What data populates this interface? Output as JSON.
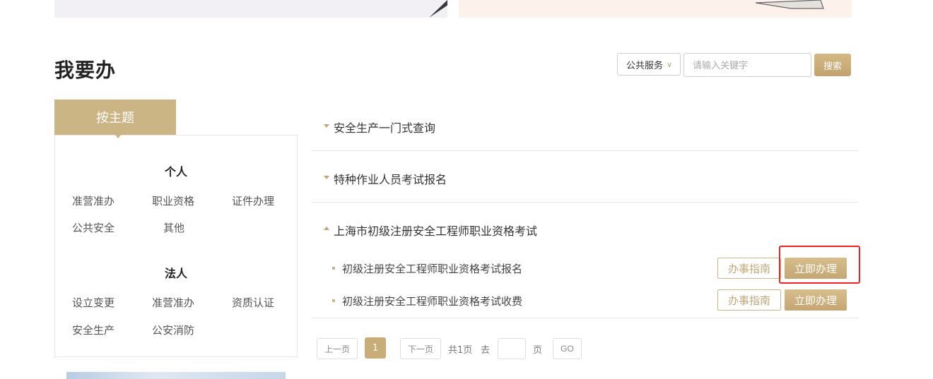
{
  "page": {
    "title": "我要办"
  },
  "search": {
    "scope_value": "公共服务",
    "placeholder": "请输入关键字",
    "button_label": "搜索"
  },
  "sidebar": {
    "tab_label": "按主题",
    "groups": [
      {
        "title": "个人",
        "items": [
          "准营准办",
          "职业资格",
          "证件办理",
          "公共安全",
          "其他"
        ]
      },
      {
        "title": "法人",
        "items": [
          "设立变更",
          "准营准办",
          "资质认证",
          "安全生产",
          "公安消防"
        ]
      }
    ]
  },
  "categories": [
    {
      "title": "安全生产一门式查询",
      "expanded": false
    },
    {
      "title": "特种作业人员考试报名",
      "expanded": false
    },
    {
      "title": "上海市初级注册安全工程师职业资格考试",
      "expanded": true,
      "items": [
        {
          "name": "初级注册安全工程师职业资格考试报名",
          "guide_label": "办事指南",
          "handle_label": "立即办理"
        },
        {
          "name": "初级注册安全工程师职业资格考试收费",
          "guide_label": "办事指南",
          "handle_label": "立即办理"
        }
      ]
    }
  ],
  "pagination": {
    "prev_label": "上一页",
    "current_page": "1",
    "next_label": "下一页",
    "total_text": "共1页",
    "goto_label": "去",
    "page_unit": "页",
    "go_label": "GO"
  },
  "colors": {
    "accent": "#cbb584",
    "highlight": "#ee2222"
  }
}
